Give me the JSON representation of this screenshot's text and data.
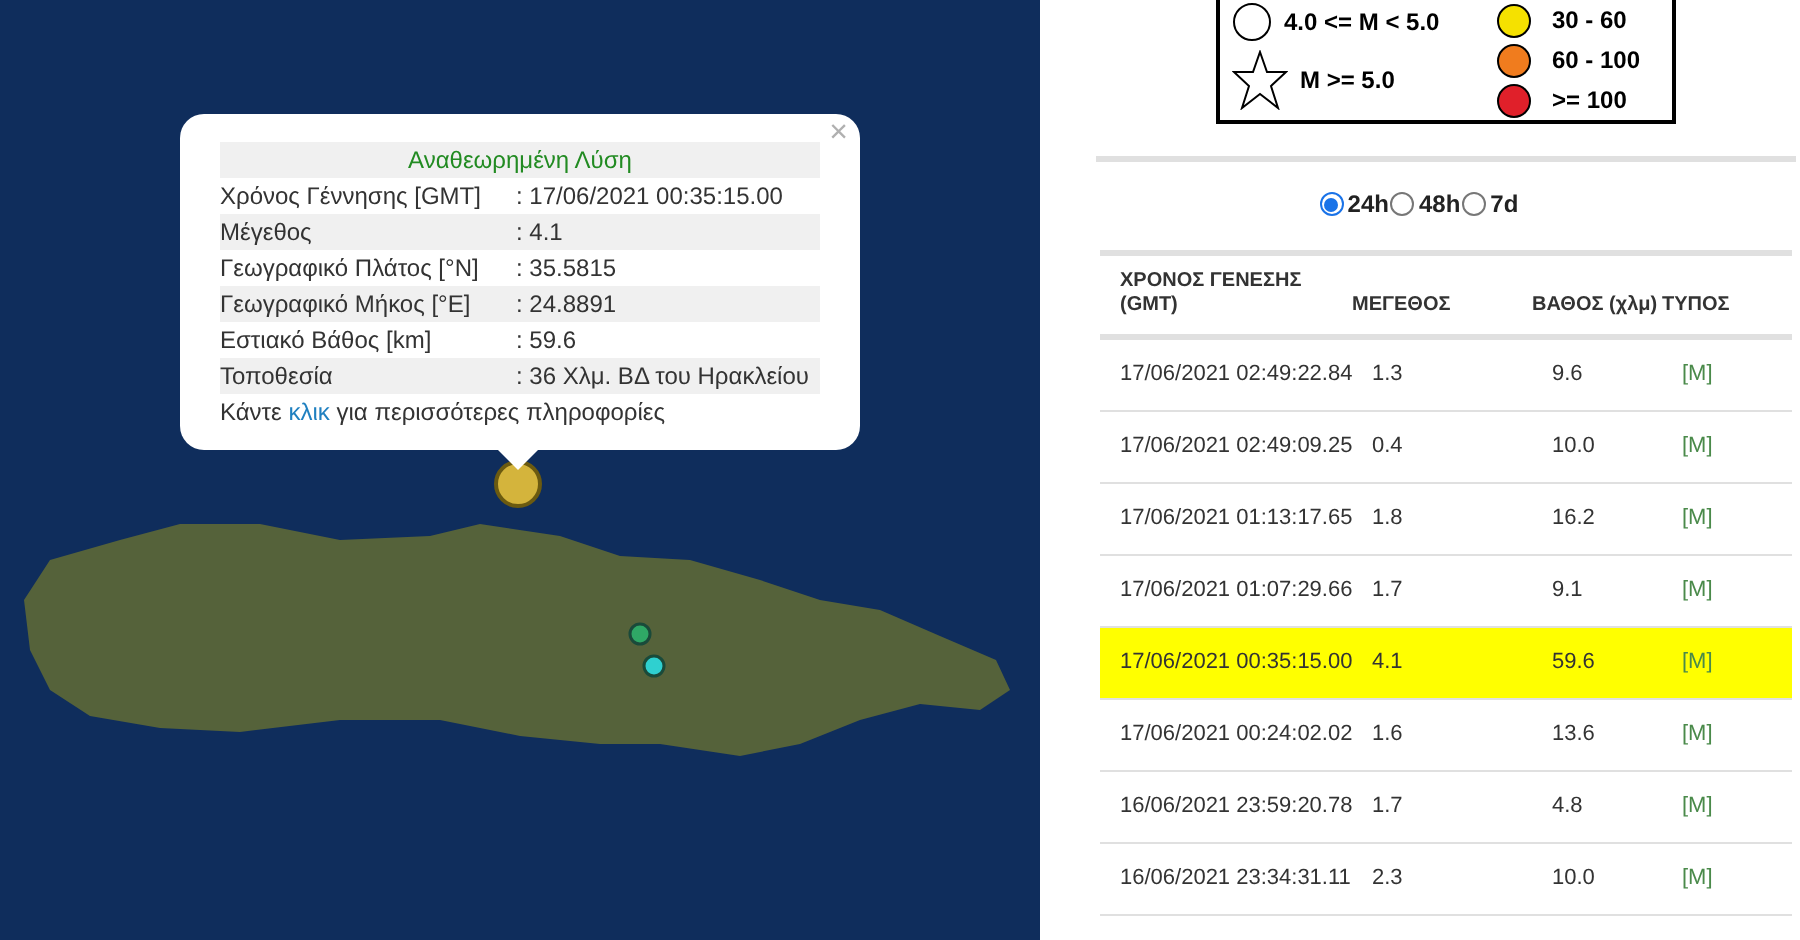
{
  "map": {
    "markers": [
      {
        "color": "#d4b43c",
        "selected": true
      },
      {
        "color": "#2fa866",
        "selected": false
      },
      {
        "color": "#2fd0d0",
        "selected": false
      }
    ]
  },
  "popup": {
    "close": "×",
    "heading": "Αναθεωρημένη Λύση",
    "rows": [
      {
        "label": "Χρόνος Γέννησης [GMT]",
        "value": ": 17/06/2021 00:35:15.00"
      },
      {
        "label": "Μέγεθος",
        "value": ": 4.1"
      },
      {
        "label": "Γεωγραφικό Πλάτος [°N]",
        "value": ": 35.5815"
      },
      {
        "label": "Γεωγραφικό Μήκος [°E]",
        "value": ": 24.8891"
      },
      {
        "label": "Εστιακό Βάθος [km]",
        "value": ": 59.6"
      },
      {
        "label": "Τοποθεσία",
        "value": ": 36 Χλμ. ΒΔ του Ηρακλείου"
      }
    ],
    "footer_before": "Κάντε",
    "footer_link": "κλικ",
    "footer_after": "για περισσότερες πληροφορίες"
  },
  "legend": {
    "magnitude": [
      {
        "kind": "circle",
        "label": "4.0 <= M < 5.0"
      },
      {
        "kind": "star",
        "label": "M >= 5.0"
      }
    ],
    "depth": [
      {
        "label": "30 - 60",
        "color": "#f5e100"
      },
      {
        "label": "60 - 100",
        "color": "#f07c1e"
      },
      {
        "label": ">= 100",
        "color": "#e0202a"
      }
    ]
  },
  "periods": [
    {
      "label": "24h",
      "selected": true
    },
    {
      "label": "48h",
      "selected": false
    },
    {
      "label": "7d",
      "selected": false
    }
  ],
  "table": {
    "columns": [
      "ΧΡΟΝΟΣ ΓΕΝΕΣΗΣ (GMT)",
      "ΜΕΓΕΘΟΣ",
      "ΒΑΘΟΣ (χλμ)",
      "ΤΥΠΟΣ"
    ],
    "rows": [
      {
        "time": "17/06/2021 02:49:22.84",
        "magnitude": "1.3",
        "depth": "9.6",
        "type": "[M]",
        "selected": false
      },
      {
        "time": "17/06/2021 02:49:09.25",
        "magnitude": "0.4",
        "depth": "10.0",
        "type": "[M]",
        "selected": false
      },
      {
        "time": "17/06/2021 01:13:17.65",
        "magnitude": "1.8",
        "depth": "16.2",
        "type": "[M]",
        "selected": false
      },
      {
        "time": "17/06/2021 01:07:29.66",
        "magnitude": "1.7",
        "depth": "9.1",
        "type": "[M]",
        "selected": false
      },
      {
        "time": "17/06/2021 00:35:15.00",
        "magnitude": "4.1",
        "depth": "59.6",
        "type": "[M]",
        "selected": true
      },
      {
        "time": "17/06/2021 00:24:02.02",
        "magnitude": "1.6",
        "depth": "13.6",
        "type": "[M]",
        "selected": false
      },
      {
        "time": "16/06/2021 23:59:20.78",
        "magnitude": "1.7",
        "depth": "4.8",
        "type": "[M]",
        "selected": false
      },
      {
        "time": "16/06/2021 23:34:31.11",
        "magnitude": "2.3",
        "depth": "10.0",
        "type": "[M]",
        "selected": false
      }
    ]
  }
}
